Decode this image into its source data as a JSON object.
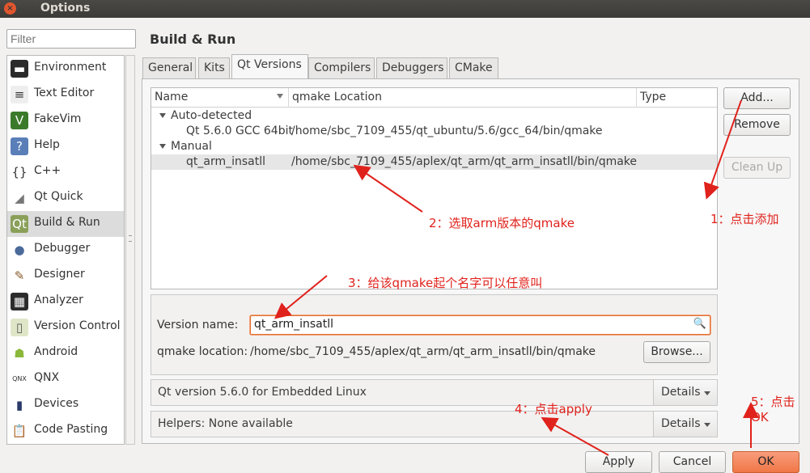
{
  "window": {
    "title": "Options",
    "close_glyph": "×"
  },
  "filter": {
    "placeholder": "Filter"
  },
  "categories": [
    {
      "label": "Environment",
      "icon": "monitor-icon",
      "glyph": "▬",
      "bg": "#2b2b2b",
      "fg": "#ffffff"
    },
    {
      "label": "Text Editor",
      "icon": "text-editor-icon",
      "glyph": "≡",
      "bg": "#eeeeee",
      "fg": "#333333"
    },
    {
      "label": "FakeVim",
      "icon": "fakevim-icon",
      "glyph": "V",
      "bg": "#3b7a2b",
      "fg": "#ffffff"
    },
    {
      "label": "Help",
      "icon": "help-icon",
      "glyph": "?",
      "bg": "#5a7fb8",
      "fg": "#ffffff"
    },
    {
      "label": "C++",
      "icon": "cpp-icon",
      "glyph": "{}",
      "bg": "#ffffff",
      "fg": "#333333"
    },
    {
      "label": "Qt Quick",
      "icon": "qt-quick-icon",
      "glyph": "◢",
      "bg": "#ffffff",
      "fg": "#777777"
    },
    {
      "label": "Build & Run",
      "icon": "build-run-icon",
      "glyph": "Qt",
      "bg": "#8aa05a",
      "fg": "#ffffff"
    },
    {
      "label": "Debugger",
      "icon": "debugger-icon",
      "glyph": "●",
      "bg": "#ffffff",
      "fg": "#4a6a9a"
    },
    {
      "label": "Designer",
      "icon": "designer-icon",
      "glyph": "✎",
      "bg": "#ffffff",
      "fg": "#8a5a2a"
    },
    {
      "label": "Analyzer",
      "icon": "analyzer-icon",
      "glyph": "▦",
      "bg": "#2b2b2b",
      "fg": "#ffffff"
    },
    {
      "label": "Version Control",
      "icon": "version-control-icon",
      "glyph": "▯",
      "bg": "#dfe6c8",
      "fg": "#555555"
    },
    {
      "label": "Android",
      "icon": "android-icon",
      "glyph": "☗",
      "bg": "#ffffff",
      "fg": "#8bb83a"
    },
    {
      "label": "QNX",
      "icon": "qnx-icon",
      "glyph": "QNX",
      "bg": "#ffffff",
      "fg": "#333333"
    },
    {
      "label": "Devices",
      "icon": "devices-icon",
      "glyph": "▮",
      "bg": "#ffffff",
      "fg": "#2a3a6a"
    },
    {
      "label": "Code Pasting",
      "icon": "code-pasting-icon",
      "glyph": "📋",
      "bg": "#ffffff",
      "fg": "#8a6a2a"
    }
  ],
  "page_title": "Build & Run",
  "tabs": [
    "General",
    "Kits",
    "Qt Versions",
    "Compilers",
    "Debuggers",
    "CMake"
  ],
  "table": {
    "columns": [
      "Name",
      "qmake Location",
      "Type"
    ],
    "groups": [
      {
        "label": "Auto-detected",
        "items": [
          {
            "name": "Qt 5.6.0 GCC 64bit",
            "location": "/home/sbc_7109_455/qt_ubuntu/5.6/gcc_64/bin/qmake"
          }
        ]
      },
      {
        "label": "Manual",
        "items": [
          {
            "name": "qt_arm_insatll",
            "location": "/home/sbc_7109_455/aplex/qt_arm/qt_arm_insatll/bin/qmake"
          }
        ]
      }
    ]
  },
  "side_buttons": {
    "add": "Add...",
    "remove": "Remove",
    "cleanup": "Clean Up"
  },
  "details": {
    "version_name_label": "Version name:",
    "version_name_value": "qt_arm_insatll",
    "qmake_location_label": "qmake location:",
    "qmake_location_value": "/home/sbc_7109_455/aplex/qt_arm/qt_arm_insatll/bin/qmake",
    "browse": "Browse..."
  },
  "info_rows": [
    {
      "text": "Qt version 5.6.0 for Embedded Linux",
      "button": "Details"
    },
    {
      "text": "Helpers: None available",
      "button": "Details"
    }
  ],
  "dialog_buttons": {
    "apply": "Apply",
    "cancel": "Cancel",
    "ok": "OK"
  },
  "annotations": {
    "a1": "1：点击添加",
    "a2": "2：选取arm版本的qmake",
    "a3": "3：给该qmake起个名字可以任意叫",
    "a4": "4：点击apply",
    "a5_line1": "5：点击",
    "a5_line2": "OK"
  },
  "colors": {
    "annotation": "#e0221c",
    "ok_button": "#f07746",
    "focus_border": "#e07030"
  }
}
